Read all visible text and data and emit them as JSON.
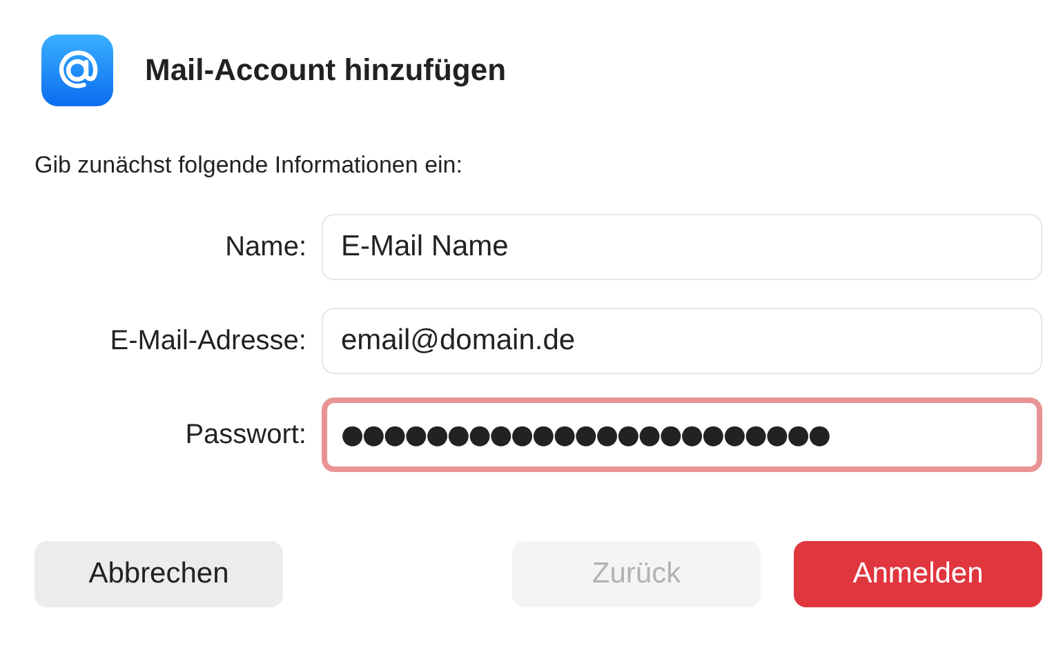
{
  "dialog": {
    "title": "Mail-Account hinzufügen",
    "prompt": "Gib zunächst folgende Informationen ein:"
  },
  "fields": [
    {
      "label": "Name:",
      "value": "E-Mail Name",
      "focused": false
    },
    {
      "label": "E-Mail-Adresse:",
      "value": "email@domain.de",
      "focused": false
    },
    {
      "label": "Passwort:",
      "value": "●●●●●●●●●●●●●●●●●●●●●●●",
      "focused": true
    }
  ],
  "buttons": [
    {
      "label": "Abbrechen",
      "kind": "plain",
      "disabled": false
    },
    {
      "label": "Zurück",
      "kind": "plain",
      "disabled": true
    },
    {
      "label": "Anmelden",
      "kind": "primary",
      "disabled": false
    }
  ]
}
